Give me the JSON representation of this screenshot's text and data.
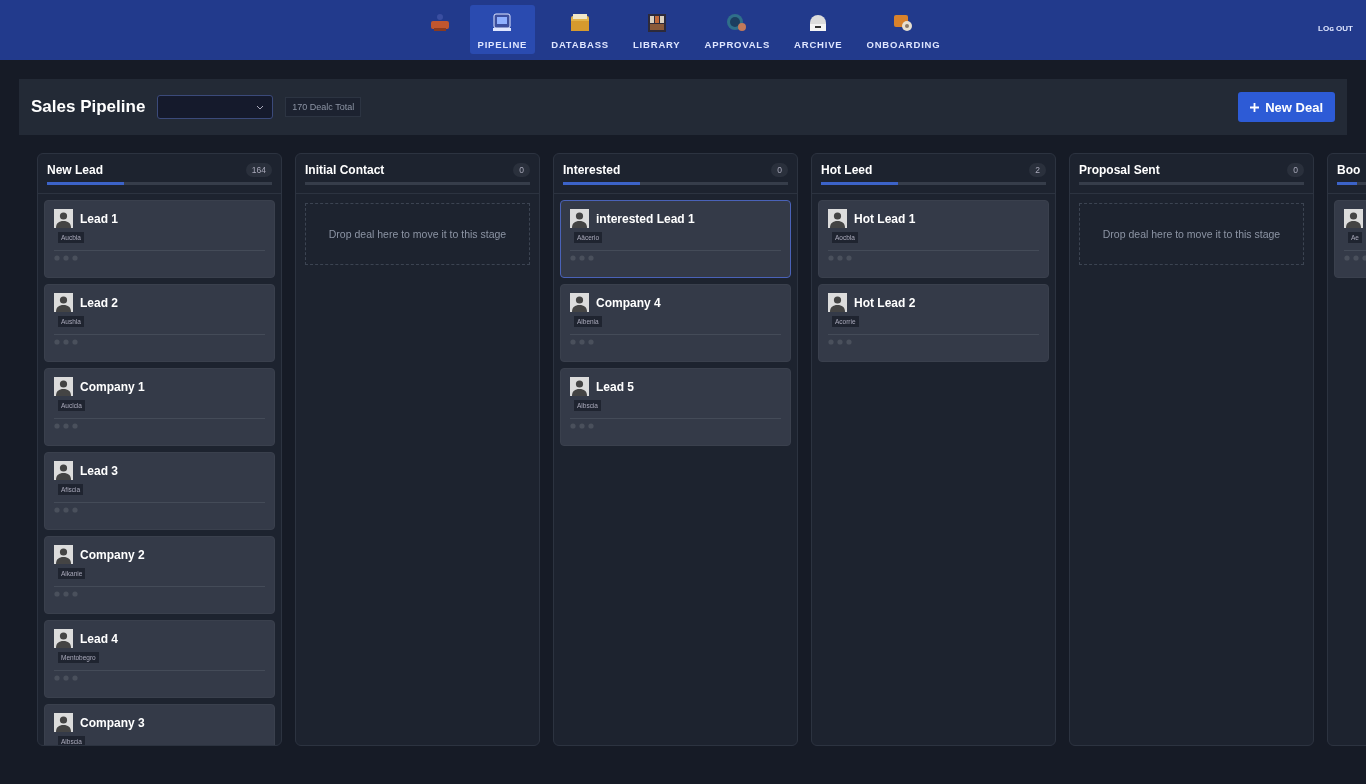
{
  "nav": {
    "items": [
      {
        "kind": "logo",
        "selected": false
      },
      {
        "kind": "pipeline",
        "label": "PIPELINE",
        "selected": true
      },
      {
        "kind": "database",
        "label": "DATABASS",
        "selected": false
      },
      {
        "kind": "library",
        "label": "LIBRARY",
        "selected": false
      },
      {
        "kind": "approvals",
        "label": "APPROVALS",
        "selected": false
      },
      {
        "kind": "archive",
        "label": "ARCHIVE",
        "selected": false
      },
      {
        "kind": "onboarding",
        "label": "ONBOARDING",
        "selected": false
      }
    ],
    "logout": "LOɢ OUT"
  },
  "header": {
    "title": "Sales Pipeline",
    "total": "170 Dealc Total",
    "new_deal": "New Deal"
  },
  "columns": [
    {
      "title": "New Lead",
      "count": "164",
      "level": 0.34,
      "cards": [
        {
          "name": "Lead 1",
          "tag": "Aucbla",
          "selected": false
        },
        {
          "name": "Lead 2",
          "tag": "Aushla",
          "selected": false
        },
        {
          "name": "Company 1",
          "tag": "Auclcla",
          "selected": false
        },
        {
          "name": "Lead 3",
          "tag": "Afiscia",
          "selected": false
        },
        {
          "name": "Company 2",
          "tag": "Aikanie",
          "selected": false
        },
        {
          "name": "Lead 4",
          "tag": "Mentobegro",
          "selected": false
        },
        {
          "name": "Company 3",
          "tag": "Albscia",
          "selected": false
        }
      ]
    },
    {
      "title": "Initial Contact",
      "count": "0",
      "drop_hint": "Drop deal here to move it to this stage"
    },
    {
      "title": "Interested",
      "count": "0",
      "level": 0.34,
      "cards": [
        {
          "name": "interested Lead 1",
          "tag": "Aäcerio",
          "selected": true
        },
        {
          "name": "Company 4",
          "tag": "Albenia",
          "selected": false
        },
        {
          "name": "Lead 5",
          "tag": "Albscia",
          "selected": false
        }
      ]
    },
    {
      "title": "Hot Leed",
      "count": "2",
      "level": 0.34,
      "cards": [
        {
          "name": "Hot Lead 1",
          "tag": "Aocbla",
          "selected": false
        },
        {
          "name": "Hot Lead 2",
          "tag": "Acorrie",
          "selected": false
        }
      ]
    },
    {
      "title": "Proposal Sent",
      "count": "0",
      "drop_hint": "Drop deal here to move it to this stage"
    },
    {
      "title": "Boo",
      "level": 0.09,
      "cards": [
        {
          "tag": "Ae",
          "selected": false
        }
      ]
    }
  ]
}
